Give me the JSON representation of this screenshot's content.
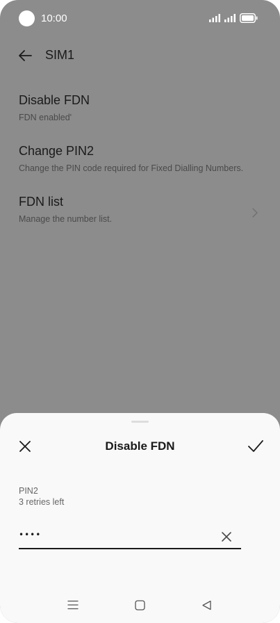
{
  "status_bar": {
    "time": "10:00",
    "icons": [
      "signal-icon",
      "signal-icon",
      "battery-icon"
    ]
  },
  "app_bar": {
    "back_icon": "arrow-left-icon",
    "title": "SIM1"
  },
  "settings": {
    "items": [
      {
        "title": "Disable FDN",
        "subtitle": "FDN enabled'"
      },
      {
        "title": "Change PIN2",
        "subtitle": "Change the PIN code required for Fixed Dialling Numbers."
      },
      {
        "title": "FDN list",
        "subtitle": "Manage the number list.",
        "icon": "chevron-right-icon"
      }
    ]
  },
  "dialog": {
    "title": "Disable FDN",
    "close_icon": "close-icon",
    "confirm_icon": "checkmark-icon",
    "field_label": "PIN2",
    "retries": "3 retries left",
    "pin_value": "••••",
    "clear_icon": "clear-icon"
  },
  "nav_bar": {
    "icons": [
      "menu-icon",
      "home-square-icon",
      "back-triangle-icon"
    ]
  },
  "colors": {
    "scrim": "#8c8c8c",
    "sheet": "#f9f9f9",
    "text": "#1a1a1a",
    "secondary_text": "#666666"
  }
}
